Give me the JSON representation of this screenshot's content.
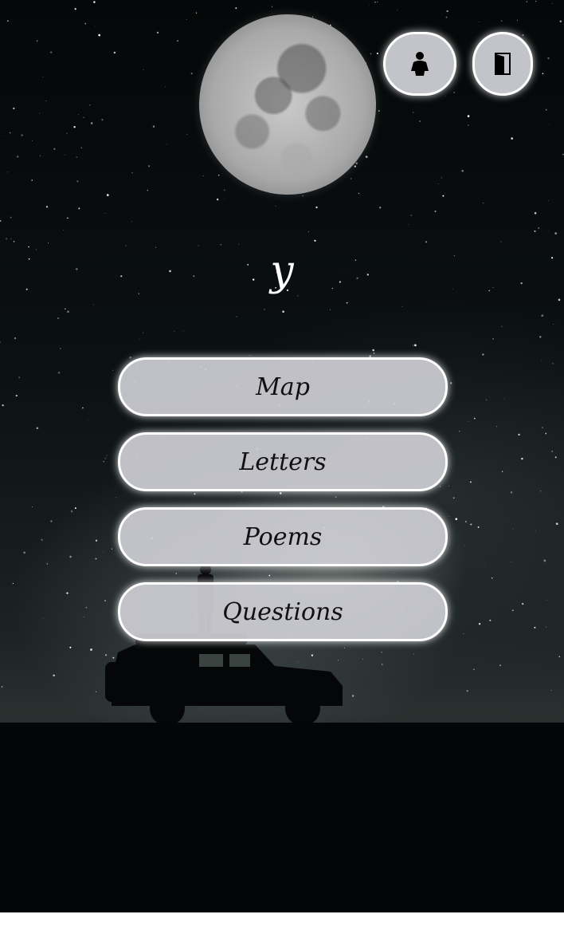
{
  "header": {
    "profile_icon": "person-icon",
    "logout_icon": "door-exit-icon"
  },
  "title": "y",
  "menu": {
    "items": [
      {
        "label": "Map"
      },
      {
        "label": "Letters"
      },
      {
        "label": "Poems"
      },
      {
        "label": "Questions"
      }
    ]
  },
  "colors": {
    "button_bg": "#c3c4ca",
    "button_border": "#ffffff",
    "title_text": "#ffffff",
    "button_text": "#111111"
  }
}
